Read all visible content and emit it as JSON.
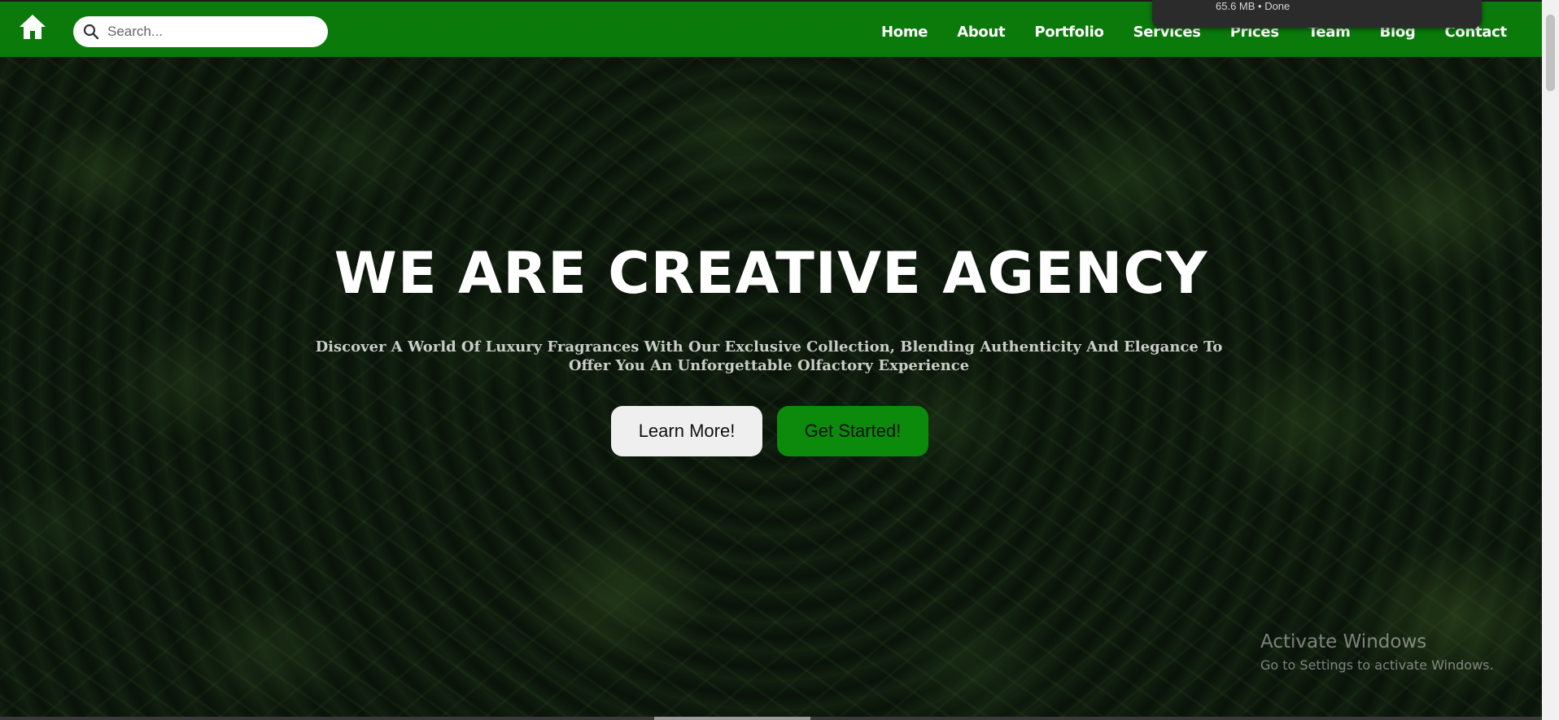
{
  "header": {
    "search_placeholder": "Search...",
    "nav_items": [
      "Home",
      "About",
      "Portfolio",
      "Services",
      "Prices",
      "Team",
      "Blog",
      "Contact"
    ],
    "nav_color": "#0a7a0a"
  },
  "download": {
    "status": "65.6 MB • Done"
  },
  "hero": {
    "title": "WE ARE CREATIVE AGENCY",
    "subtitle": "Discover A World Of Luxury Fragrances With Our Exclusive Collection, Blending Authenticity And Elegance To Offer You An Unforgettable Olfactory Experience",
    "learn_more_label": "Learn More!",
    "get_started_label": "Get Started!",
    "accent_color": "#0b8a0b"
  },
  "watermark": {
    "title": "Activate Windows",
    "subtitle": "Go to Settings to activate Windows."
  },
  "icons": {
    "home": "home-icon",
    "search": "search-icon"
  }
}
